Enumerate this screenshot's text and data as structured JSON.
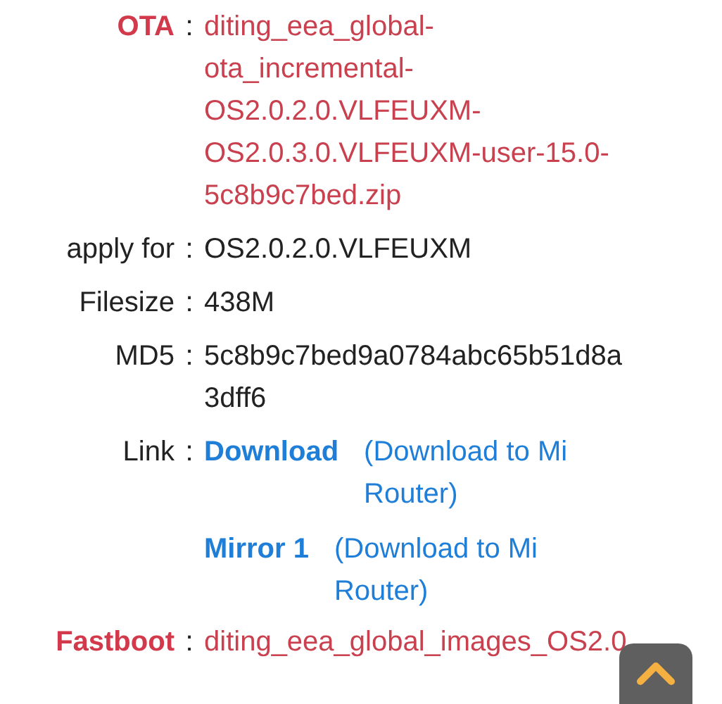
{
  "rows": [
    {
      "kind": "text",
      "label": "OTA",
      "separator": ":",
      "highlight": true,
      "value": "diting_eea_global-ota_incremental-OS2.0.2.0.VLFEUXM-OS2.0.3.0.VLFEUXM-user-15.0-5c8b9c7bed.zip"
    },
    {
      "kind": "text",
      "label": "apply for",
      "separator": ":",
      "highlight": false,
      "value": "OS2.0.2.0.VLFEUXM"
    },
    {
      "kind": "text",
      "label": "Filesize",
      "separator": ":",
      "highlight": false,
      "value": "438M"
    },
    {
      "kind": "text",
      "label": "MD5",
      "separator": ":",
      "highlight": false,
      "value": "5c8b9c7bed9a0784abc65b51d8a3dff6"
    },
    {
      "kind": "links",
      "label": "Link",
      "separator": ":",
      "highlight": false,
      "links": [
        {
          "title": "Download",
          "alt": "(Download to Mi Router)"
        },
        {
          "title": "Mirror 1",
          "alt": "(Download to Mi Router)"
        }
      ]
    },
    {
      "kind": "text",
      "label": "Fastboot",
      "separator": ":",
      "highlight": true,
      "value": "diting_eea_global_images_OS2.0"
    }
  ]
}
